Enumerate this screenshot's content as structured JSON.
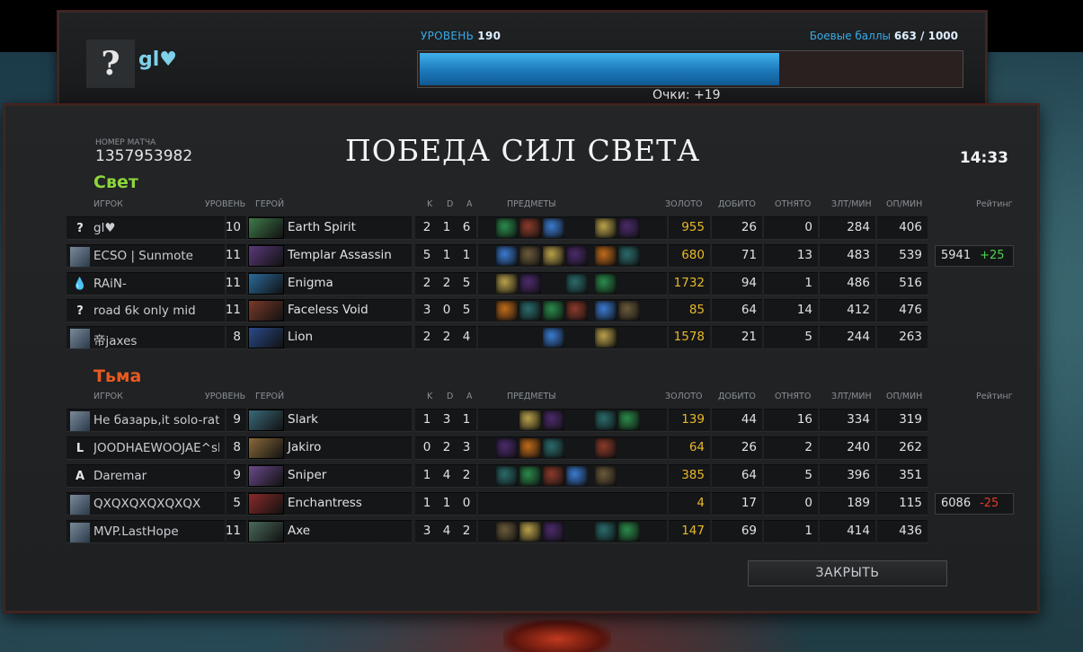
{
  "top": {
    "avatar_glyph": "?",
    "player_name": "gl♥",
    "level_label": "УРОВЕНЬ",
    "level_value": "190",
    "battle_points_label": "Боевые баллы",
    "battle_points_value": "663 / 1000",
    "battle_points_fraction": 0.663,
    "points_gained": "Очки: +19"
  },
  "match": {
    "id_label": "НОМЕР МАТЧА",
    "id": "1357953982",
    "result_title": "ПОБЕДА СИЛ СВЕТА",
    "duration": "14:33"
  },
  "columns": {
    "player": "ИГРОК",
    "level": "УРОВЕНЬ",
    "hero": "ГЕРОЙ",
    "k": "K",
    "d": "D",
    "a": "A",
    "items": "ПРЕДМЕТЫ",
    "gold": "ЗОЛОТО",
    "last_hits": "ДОБИТО",
    "denies": "ОТНЯТО",
    "gpm": "ЗЛТ/МИН",
    "xpm": "ОП/МИН",
    "rating": "Рейтинг"
  },
  "radiant": {
    "name": "Свет",
    "players": [
      {
        "icon": "?",
        "name": "gl♥",
        "level": "10",
        "hero": "Earth Spirit",
        "k": "2",
        "d": "1",
        "a": "6",
        "gold": "955",
        "lh": "26",
        "dn": "0",
        "gpm": "284",
        "xpm": "406",
        "items": [
          1,
          1,
          1,
          0,
          1,
          1
        ]
      },
      {
        "icon": "",
        "name": "ECSO | Sunmote",
        "level": "11",
        "hero": "Templar Assassin",
        "k": "5",
        "d": "1",
        "a": "1",
        "gold": "680",
        "lh": "71",
        "dn": "13",
        "gpm": "483",
        "xpm": "539",
        "items": [
          1,
          1,
          1,
          1,
          1,
          1
        ]
      },
      {
        "icon": "💧",
        "name": "RAiN-",
        "level": "11",
        "hero": "Enigma",
        "k": "2",
        "d": "2",
        "a": "5",
        "gold": "1732",
        "lh": "94",
        "dn": "1",
        "gpm": "486",
        "xpm": "516",
        "items": [
          1,
          1,
          0,
          1,
          1,
          0
        ]
      },
      {
        "icon": "?",
        "name": "road 6k only mid",
        "level": "11",
        "hero": "Faceless Void",
        "k": "3",
        "d": "0",
        "a": "5",
        "gold": "85",
        "lh": "64",
        "dn": "14",
        "gpm": "412",
        "xpm": "476",
        "items": [
          1,
          1,
          1,
          1,
          1,
          1
        ]
      },
      {
        "icon": "",
        "name": "帝jaxes",
        "level": "8",
        "hero": "Lion",
        "k": "2",
        "d": "2",
        "a": "4",
        "gold": "1578",
        "lh": "21",
        "dn": "5",
        "gpm": "244",
        "xpm": "263",
        "items": [
          0,
          0,
          1,
          0,
          1,
          0
        ]
      }
    ]
  },
  "dire": {
    "name": "Тьма",
    "players": [
      {
        "icon": "",
        "name": "Не базарь,it solo-rating",
        "level": "9",
        "hero": "Slark",
        "k": "1",
        "d": "3",
        "a": "1",
        "gold": "139",
        "lh": "44",
        "dn": "16",
        "gpm": "334",
        "xpm": "319",
        "items": [
          0,
          1,
          1,
          0,
          1,
          1
        ]
      },
      {
        "icon": "L",
        "name": "JOODHAEWOOJAE^sl",
        "level": "8",
        "hero": "Jakiro",
        "k": "0",
        "d": "2",
        "a": "3",
        "gold": "64",
        "lh": "26",
        "dn": "2",
        "gpm": "240",
        "xpm": "262",
        "items": [
          1,
          1,
          1,
          0,
          1,
          0
        ]
      },
      {
        "icon": "A",
        "name": "Daremar",
        "level": "9",
        "hero": "Sniper",
        "k": "1",
        "d": "4",
        "a": "2",
        "gold": "385",
        "lh": "64",
        "dn": "5",
        "gpm": "396",
        "xpm": "351",
        "items": [
          1,
          1,
          1,
          1,
          1,
          0
        ]
      },
      {
        "icon": "",
        "name": "QXQXQXQXQXQX",
        "level": "5",
        "hero": "Enchantress",
        "k": "1",
        "d": "1",
        "a": "0",
        "gold": "4",
        "lh": "17",
        "dn": "0",
        "gpm": "189",
        "xpm": "115",
        "items": [
          0,
          0,
          0,
          0,
          0,
          0
        ]
      },
      {
        "icon": "",
        "name": "MVP.LastHope",
        "level": "11",
        "hero": "Axe",
        "k": "3",
        "d": "4",
        "a": "2",
        "gold": "147",
        "lh": "69",
        "dn": "1",
        "gpm": "414",
        "xpm": "436",
        "items": [
          1,
          1,
          1,
          0,
          1,
          1
        ]
      }
    ]
  },
  "ratings": [
    {
      "value": "5941",
      "delta": "+25"
    },
    {
      "value": "6086",
      "delta": "-25"
    }
  ],
  "close_label": "ЗАКРЫТЬ",
  "colors": {
    "radiant": "#8dd63c",
    "dire": "#e75a1f",
    "gold": "#e8b92a",
    "xp_bar": "#2a95d4",
    "rating_up": "#4bd14b",
    "rating_down": "#e23a2a"
  }
}
